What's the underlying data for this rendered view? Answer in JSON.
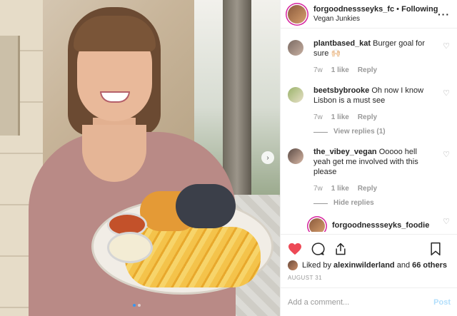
{
  "colors": {
    "accent": "#3897f0",
    "like_red": "#ed4956",
    "story_ring": "#d6249f",
    "muted": "#999999"
  },
  "header": {
    "username": "forgoodnessseyks_fc",
    "follow_label": "Following",
    "separator": "•",
    "location": "Vegan Junkies",
    "more_icon": "more-dots-icon"
  },
  "comments": [
    {
      "username": "plantbased_kat",
      "text": "Burger goal for sure 🙌🏻",
      "age": "7w",
      "likes": "1 like",
      "reply_label": "Reply"
    },
    {
      "username": "beetsbybrooke",
      "text": "Oh now I know Lisbon is a must see",
      "age": "7w",
      "likes": "1 like",
      "reply_label": "Reply",
      "view_replies": "View replies (1)"
    },
    {
      "username": "the_vibey_vegan",
      "text": "Ooooo hell yeah get me involved with this please",
      "age": "7w",
      "likes": "1 like",
      "reply_label": "Reply",
      "hide_replies": "Hide replies"
    }
  ],
  "nested_reply": {
    "username": "forgoodnessseyks_foodie"
  },
  "actions": {
    "like_icon": "heart-filled-icon",
    "comment_icon": "comment-icon",
    "share_icon": "share-icon",
    "save_icon": "bookmark-icon"
  },
  "likes": {
    "prefix": "Liked by",
    "user": "alexinwilderland",
    "and": "and",
    "others": "66 others"
  },
  "date": "AUGUST 31",
  "add_comment": {
    "placeholder": "Add a comment...",
    "post_label": "Post"
  },
  "carousel": {
    "total": 2,
    "current": 1
  }
}
